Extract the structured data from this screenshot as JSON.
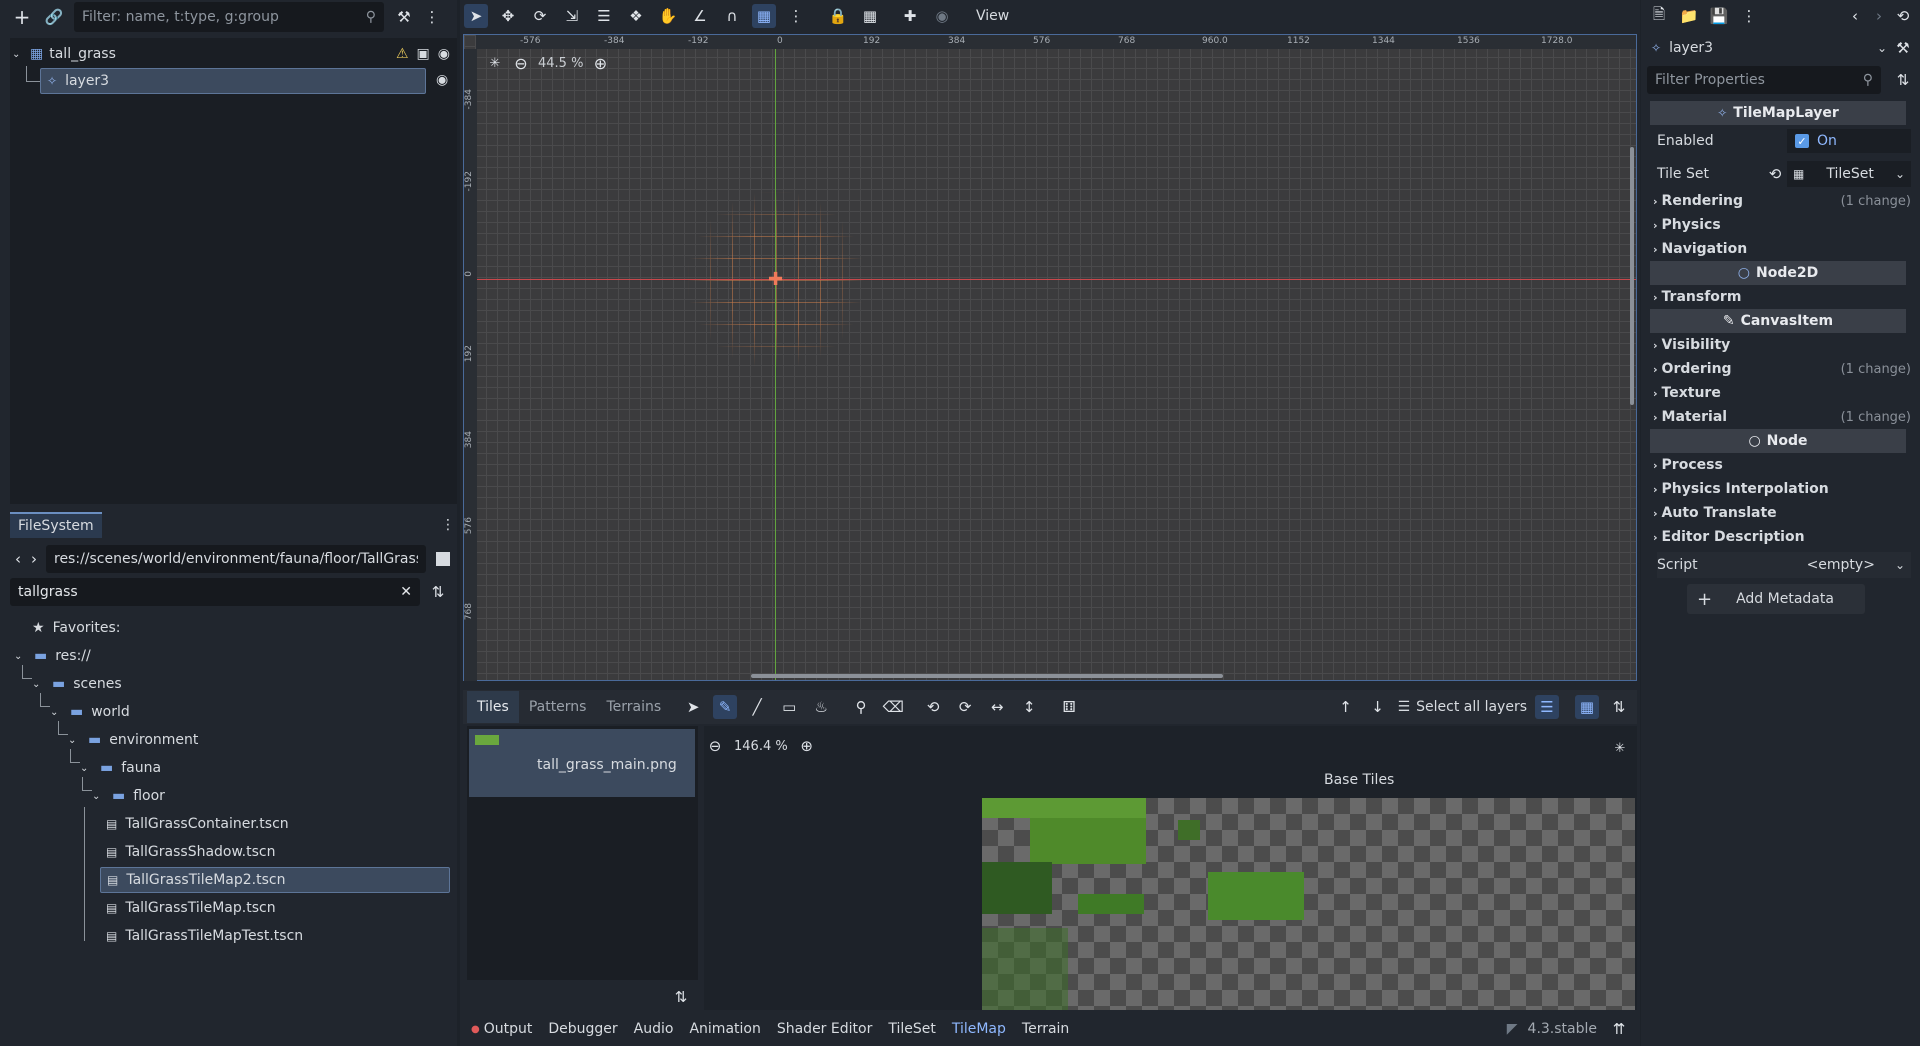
{
  "scene": {
    "filter_placeholder": "Filter: name, t:type, g:group",
    "nodes": [
      {
        "label": "tall_grass"
      },
      {
        "label": "layer3"
      }
    ]
  },
  "filesystem": {
    "tab_label": "FileSystem",
    "path": "res://scenes/world/environment/fauna/floor/TallGrass",
    "search_value": "tallgrass",
    "favorites_label": "Favorites:",
    "items": [
      {
        "label": "res://",
        "type": "folder"
      },
      {
        "label": "scenes",
        "type": "folder"
      },
      {
        "label": "world",
        "type": "folder"
      },
      {
        "label": "environment",
        "type": "folder"
      },
      {
        "label": "fauna",
        "type": "folder"
      },
      {
        "label": "floor",
        "type": "folder"
      },
      {
        "label": "TallGrassContainer.tscn",
        "type": "scene"
      },
      {
        "label": "TallGrassShadow.tscn",
        "type": "scene"
      },
      {
        "label": "TallGrassTileMap2.tscn",
        "type": "scene",
        "selected": true
      },
      {
        "label": "TallGrassTileMap.tscn",
        "type": "scene"
      },
      {
        "label": "TallGrassTileMapTest.tscn",
        "type": "scene"
      }
    ]
  },
  "viewport": {
    "menu_view": "View",
    "zoom": "44.5 %",
    "ruler_top": [
      "-576",
      "-384",
      "-192",
      "0",
      "192",
      "384",
      "576",
      "768",
      "960.0",
      "1152",
      "1344",
      "1536",
      "1728.0"
    ],
    "ruler_left": [
      "-384",
      "-192",
      "0",
      "192",
      "384",
      "576",
      "768"
    ]
  },
  "tilemap": {
    "tabs": [
      "Tiles",
      "Patterns",
      "Terrains"
    ],
    "active_tab": "Tiles",
    "select_all_layers": "Select all layers",
    "source_name": "tall_grass_main.png",
    "atlas_zoom": "146.4 %",
    "atlas_title": "Base Tiles"
  },
  "bottom": {
    "tabs": [
      "Output",
      "Debugger",
      "Audio",
      "Animation",
      "Shader Editor",
      "TileSet",
      "TileMap",
      "Terrain"
    ],
    "active_tab": "TileMap",
    "version": "4.3.stable"
  },
  "inspector": {
    "node_name": "layer3",
    "filter_placeholder": "Filter Properties",
    "class_tilemaplayer": "TileMapLayer",
    "enabled_label": "Enabled",
    "enabled_value": "On",
    "tileset_label": "Tile Set",
    "tileset_value": "TileSet",
    "tilemap_sections": [
      {
        "label": "Rendering",
        "change": "(1 change)"
      },
      {
        "label": "Physics",
        "change": ""
      },
      {
        "label": "Navigation",
        "change": ""
      }
    ],
    "class_node2d": "Node2D",
    "node2d_sections": [
      {
        "label": "Transform",
        "change": ""
      }
    ],
    "class_canvasitem": "CanvasItem",
    "canvas_sections": [
      {
        "label": "Visibility",
        "change": ""
      },
      {
        "label": "Ordering",
        "change": "(1 change)"
      },
      {
        "label": "Texture",
        "change": ""
      },
      {
        "label": "Material",
        "change": "(1 change)"
      }
    ],
    "class_node": "Node",
    "node_sections": [
      {
        "label": "Process",
        "change": ""
      },
      {
        "label": "Physics Interpolation",
        "change": ""
      },
      {
        "label": "Auto Translate",
        "change": ""
      },
      {
        "label": "Editor Description",
        "change": ""
      }
    ],
    "script_label": "Script",
    "script_value": "<empty>",
    "add_metadata": "Add Metadata"
  },
  "colors": {
    "accent": "#6b8fc1",
    "selection": "#3c4a5e",
    "x_axis": "#c9484c",
    "y_axis": "#63a53f",
    "grid_orange": "#e0874d"
  }
}
